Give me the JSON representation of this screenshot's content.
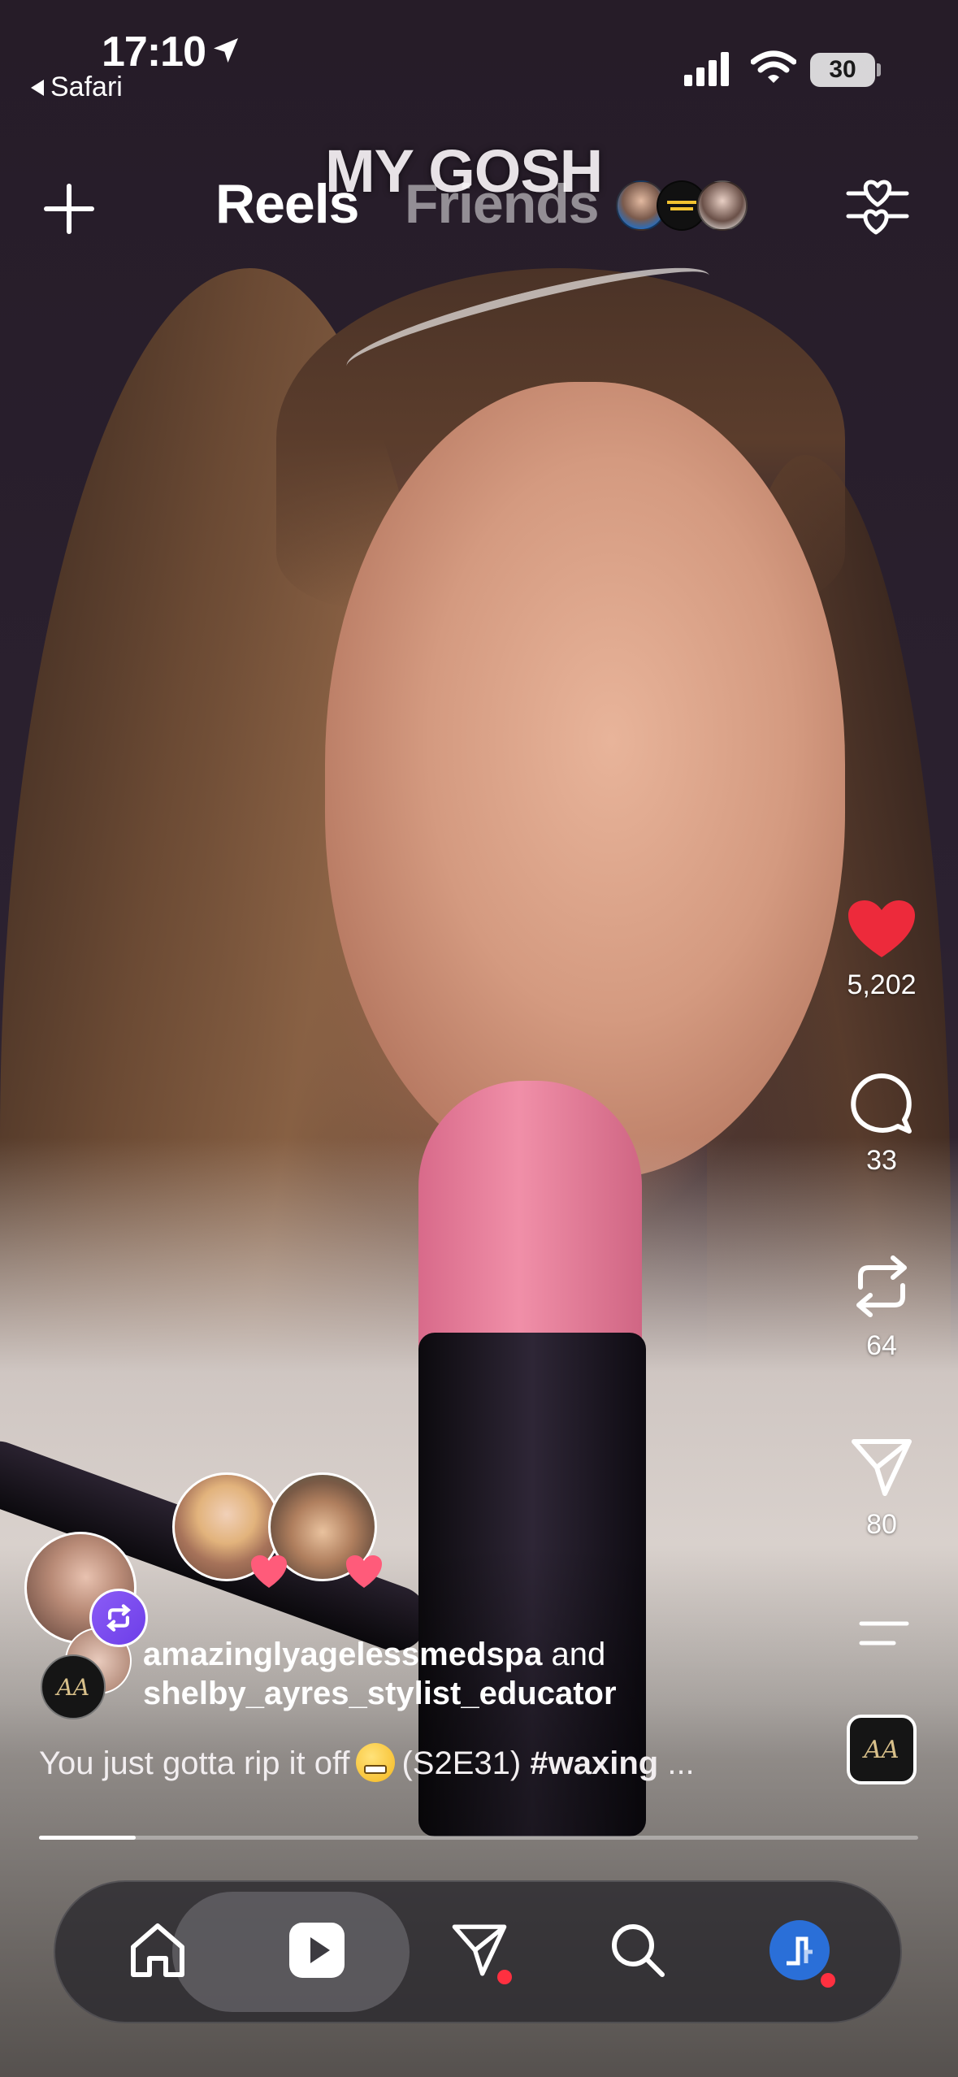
{
  "status_bar": {
    "time": "17:10",
    "back_app": "Safari",
    "battery": "30"
  },
  "top_nav": {
    "overlay_caption": "MY GOSH",
    "tabs": [
      {
        "label": "Reels",
        "active": true
      },
      {
        "label": "Friends",
        "active": false
      }
    ],
    "icons": {
      "create": "plus-icon",
      "filter": "heart-sliders-icon"
    }
  },
  "actions": {
    "likes": "5,202",
    "comments": "33",
    "reposts": "64",
    "shares": "80",
    "liked": true,
    "like_color": "#ed2a3b"
  },
  "post": {
    "user_primary": "amazinglyagelessmedspa",
    "joiner": "and",
    "user_secondary": "shelby_ayres_stylist_educator",
    "caption_text": "You just gotta rip it off",
    "caption_episode": "(S2E31)",
    "caption_hashtag": "#waxing",
    "caption_more": "...",
    "emoji": "grimacing-face",
    "progress": 0.11
  },
  "tab_bar": {
    "items": [
      {
        "name": "home",
        "icon": "home-icon",
        "active": false
      },
      {
        "name": "reels",
        "icon": "reels-play-icon",
        "active": true
      },
      {
        "name": "messages",
        "icon": "direct-send-icon",
        "active": false,
        "badge": true
      },
      {
        "name": "search",
        "icon": "search-icon",
        "active": false
      },
      {
        "name": "profile",
        "icon": "profile-avatar",
        "active": false,
        "badge": true
      }
    ],
    "accent": "#ff3040"
  }
}
